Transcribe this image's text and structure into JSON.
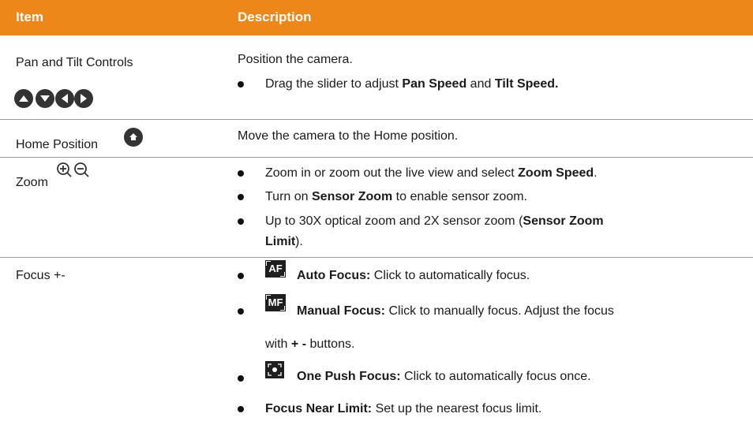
{
  "header": {
    "item": "Item",
    "description": "Description"
  },
  "rows": [
    {
      "item": "Pan and Tilt Controls",
      "icons": [
        "up-arrow-icon",
        "down-arrow-icon",
        "left-arrow-icon",
        "right-arrow-icon"
      ],
      "lines": [
        {
          "plain": "Position the camera."
        },
        {
          "t1": "Drag the slider to adjust ",
          "b1": "Pan Speed",
          "t2": " and ",
          "b2": "Tilt Speed."
        }
      ]
    },
    {
      "item": "Home Position",
      "icon": "home-icon",
      "lines": [
        {
          "plain": "Move the camera to the Home position."
        }
      ]
    },
    {
      "item": "Zoom",
      "icons": [
        "zoom-in-icon",
        "zoom-out-icon"
      ],
      "lines": [
        {
          "t1": "Zoom in or zoom out the live view and select ",
          "b1": "Zoom Speed",
          "t2": "."
        },
        {
          "t1": "Turn on ",
          "b1": "Sensor Zoom",
          "t2": " to enable sensor zoom."
        },
        {
          "t1": "Up to 30X optical zoom and 2X sensor zoom (",
          "b1": "Sensor Zoom",
          "b1b": "Limit",
          "t2": ")."
        }
      ]
    },
    {
      "item": "Focus +-",
      "lines": [
        {
          "icon": "AF",
          "b1": "Auto Focus:",
          "t2": " Click to automatically focus."
        },
        {
          "icon": "MF",
          "b1": "Manual Focus:",
          "t2": " Click to manually focus. Adjust the focus",
          "t3": "with ",
          "b3": "+ -",
          "t4": " buttons."
        },
        {
          "icon": "one-push-focus-icon",
          "b1": "One Push Focus:",
          "t2": " Click to automatically focus once."
        },
        {
          "b1": "Focus Near Limit:",
          "t2": " Set up the nearest focus limit."
        }
      ]
    }
  ]
}
